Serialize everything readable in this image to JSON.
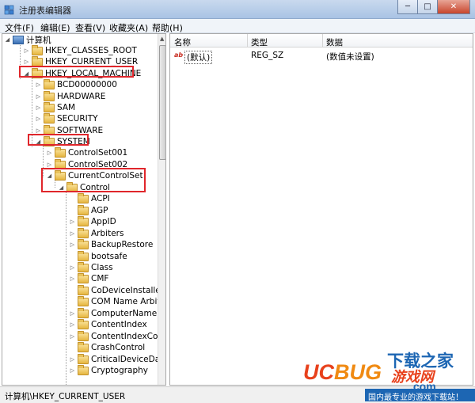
{
  "window": {
    "title": "注册表编辑器",
    "minimize_glyph": "─",
    "maximize_glyph": "□",
    "close_glyph": "✕"
  },
  "menu": [
    "文件(F)",
    "编辑(E)",
    "查看(V)",
    "收藏夹(A)",
    "帮助(H)"
  ],
  "tree": {
    "root": "计算机",
    "items": [
      {
        "label": "HKEY_CLASSES_ROOT"
      },
      {
        "label": "HKEY_CURRENT_USER"
      },
      {
        "label": "HKEY_LOCAL_MACHINE"
      },
      {
        "label": "BCD00000000"
      },
      {
        "label": "HARDWARE"
      },
      {
        "label": "SAM"
      },
      {
        "label": "SECURITY"
      },
      {
        "label": "SOFTWARE"
      },
      {
        "label": "SYSTEM"
      },
      {
        "label": "ControlSet001"
      },
      {
        "label": "ControlSet002"
      },
      {
        "label": "CurrentControlSet"
      },
      {
        "label": "Control"
      },
      {
        "label": "ACPI"
      },
      {
        "label": "AGP"
      },
      {
        "label": "AppID"
      },
      {
        "label": "Arbiters"
      },
      {
        "label": "BackupRestore"
      },
      {
        "label": "bootsafe"
      },
      {
        "label": "Class"
      },
      {
        "label": "CMF"
      },
      {
        "label": "CoDeviceInstallers"
      },
      {
        "label": "COM Name Arbite"
      },
      {
        "label": "ComputerName"
      },
      {
        "label": "ContentIndex"
      },
      {
        "label": "ContentIndexCom"
      },
      {
        "label": "CrashControl"
      },
      {
        "label": "CriticalDeviceData"
      },
      {
        "label": "Cryptography"
      }
    ]
  },
  "list": {
    "columns": [
      "名称",
      "类型",
      "数据"
    ],
    "rows": [
      {
        "icon": "ab",
        "name": "(默认)",
        "type": "REG_SZ",
        "data": "(数值未设置)"
      }
    ]
  },
  "status": {
    "path": "计算机\\HKEY_CURRENT_USER"
  },
  "watermark": {
    "line1": "下载之家",
    "uc": "UC",
    "bug": "BUG",
    "line3": "游戏网",
    "line4": ".com",
    "tagline": "国内最专业的游戏下载站！"
  },
  "colors": {
    "annotation_red": "#e0262b",
    "titlebar_blue": "#a9c3e4",
    "folder_yellow": "#e6b63f"
  }
}
